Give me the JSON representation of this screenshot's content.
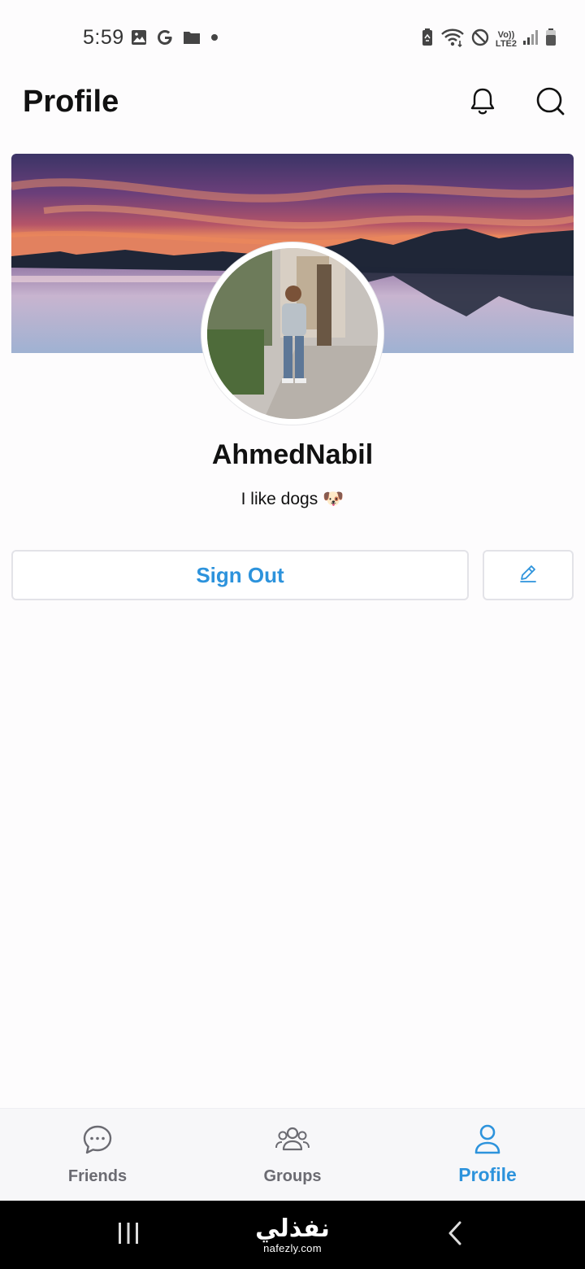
{
  "status_bar": {
    "time": "5:59",
    "left_icons": [
      "image-icon",
      "google-icon",
      "folder-icon",
      "dot-icon"
    ],
    "right_icons": [
      "battery-saver-icon",
      "wifi-icon",
      "do-not-disturb-icon",
      "volte-icon",
      "signal-icon",
      "battery-icon"
    ],
    "volte_top": "Vo))",
    "volte_bottom": "LTE2"
  },
  "header": {
    "title": "Profile",
    "notifications_icon": "bell-icon",
    "search_icon": "search-icon"
  },
  "profile": {
    "username": "AhmedNabil",
    "bio": "I like dogs",
    "bio_emoji": "🐶",
    "sign_out_label": "Sign Out",
    "edit_icon": "pencil-icon"
  },
  "tabs": [
    {
      "label": "Friends",
      "icon": "chat-bubble-icon",
      "active": false
    },
    {
      "label": "Groups",
      "icon": "group-icon",
      "active": false
    },
    {
      "label": "Profile",
      "icon": "user-icon",
      "active": true
    }
  ],
  "navbar": {
    "watermark_arabic": "نفذلي",
    "watermark_url": "nafezly.com"
  },
  "colors": {
    "accent": "#2d93dc",
    "inactive_tab": "#6b6b72",
    "background": "#fdfcfd"
  }
}
